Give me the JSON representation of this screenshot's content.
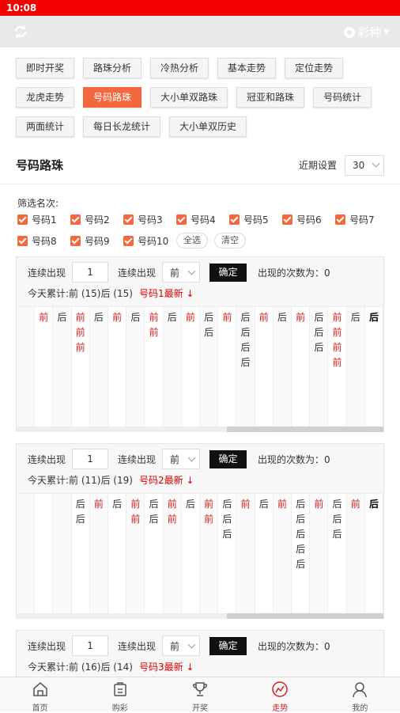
{
  "status": {
    "time": "10:08"
  },
  "header": {
    "lottery_label": "彩种"
  },
  "nav": [
    "即时开奖",
    "路珠分析",
    "冷热分析",
    "基本走势",
    "定位走势",
    "龙虎走势",
    "号码路珠",
    "大小单双路珠",
    "冠亚和路珠",
    "号码统计",
    "两面统计",
    "每日长龙统计",
    "大小单双历史"
  ],
  "section": {
    "title": "号码路珠",
    "period_label": "近期设置",
    "period_value": "30"
  },
  "filter": {
    "label": "筛选名次:",
    "items": [
      "号码1",
      "号码2",
      "号码3",
      "号码4",
      "号码5",
      "号码6",
      "号码7",
      "号码8",
      "号码9",
      "号码10"
    ],
    "select_all": "全选",
    "clear": "清空"
  },
  "panels": [
    {
      "consecutive_label": "连续出现",
      "count": "1",
      "consecutive_label2": "连续出现",
      "dir": "前",
      "ok": "确定",
      "times_label": "出现的次数为：0",
      "summary": "今天累计:前 (15)后 (15)",
      "latest": "号码1最新 ↓",
      "columns": [
        [],
        [
          "前"
        ],
        [
          "后"
        ],
        [
          "前",
          "前",
          "前"
        ],
        [
          "后"
        ],
        [
          "前"
        ],
        [
          "后"
        ],
        [
          "前",
          "前"
        ],
        [
          "后"
        ],
        [
          "前"
        ],
        [
          "后",
          "后"
        ],
        [
          "前"
        ],
        [
          "后",
          "后",
          "后",
          "后"
        ],
        [
          "前"
        ],
        [
          "后"
        ],
        [
          "前"
        ],
        [
          "后",
          "后",
          "后"
        ],
        [
          "前",
          "前",
          "前",
          "前"
        ],
        [
          "后"
        ],
        [
          "后"
        ]
      ]
    },
    {
      "consecutive_label": "连续出现",
      "count": "1",
      "consecutive_label2": "连续出现",
      "dir": "前",
      "ok": "确定",
      "times_label": "出现的次数为：0",
      "summary": "今天累计:前 (11)后 (19)",
      "latest": "号码2最新 ↓",
      "columns": [
        [],
        [],
        [],
        [
          "后",
          "后"
        ],
        [
          "前"
        ],
        [
          "后"
        ],
        [
          "前",
          "前"
        ],
        [
          "后",
          "后"
        ],
        [
          "前",
          "前"
        ],
        [
          "后"
        ],
        [
          "前",
          "前"
        ],
        [
          "后",
          "后",
          "后"
        ],
        [
          "前"
        ],
        [
          "后"
        ],
        [
          "前"
        ],
        [
          "后",
          "后",
          "后",
          "后",
          "后"
        ],
        [
          "前"
        ],
        [
          "后",
          "后",
          "后"
        ],
        [
          "前"
        ],
        [
          "后"
        ]
      ]
    },
    {
      "consecutive_label": "连续出现",
      "count": "1",
      "consecutive_label2": "连续出现",
      "dir": "前",
      "ok": "确定",
      "times_label": "出现的次数为：0",
      "summary": "今天累计:前 (16)后 (14)",
      "latest": "号码3最新 ↓",
      "columns": []
    }
  ],
  "tabs": [
    "首页",
    "购彩",
    "开奖",
    "走势",
    "我的"
  ],
  "active_tab": 3
}
